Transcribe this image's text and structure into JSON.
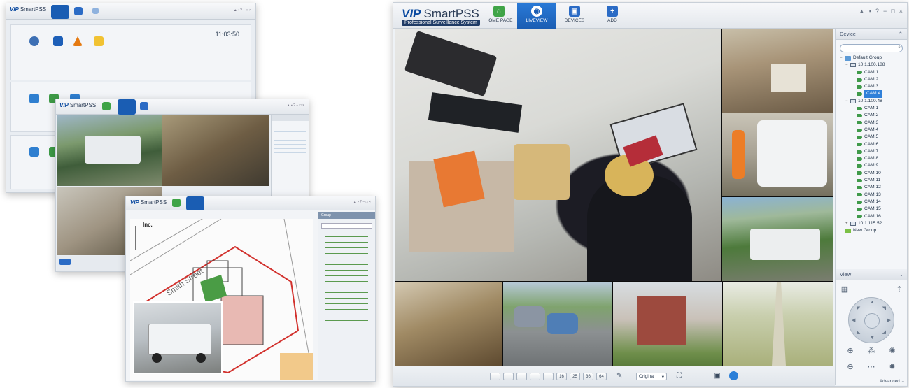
{
  "app": {
    "logo_text": "VIP",
    "product": "SmartPSS",
    "subtitle": "Professional Surveillance System"
  },
  "colors": {
    "accent": "#1a5db3",
    "selection": "#2f80d9",
    "camera_icon": "#3f9a4a"
  },
  "nav_tabs": [
    {
      "label": "HOME PAGE",
      "icon": "home-icon",
      "color": "#3fa447"
    },
    {
      "label": "LIVEVIEW",
      "icon": "camera-icon",
      "color": "#ffffff",
      "active": true
    },
    {
      "label": "DEVICES",
      "icon": "devices-icon",
      "color": "#2b6bc5"
    },
    {
      "label": "ADD",
      "icon": "plus-icon",
      "color": "#2b6bc5"
    }
  ],
  "sidebar": {
    "device_header": "Device",
    "root_group": "Default Group",
    "devices": [
      {
        "ip": "10.1.100.188",
        "cameras": [
          "CAM 1",
          "CAM 2",
          "CAM 3",
          "CAM 4"
        ],
        "selected": "CAM 4"
      },
      {
        "ip": "10.1.100.48",
        "cameras": [
          "CAM 1",
          "CAM 2",
          "CAM 3",
          "CAM 4",
          "CAM 5",
          "CAM 6",
          "CAM 7",
          "CAM 8",
          "CAM 9",
          "CAM 10",
          "CAM 11",
          "CAM 12",
          "CAM 13",
          "CAM 14",
          "CAM 15",
          "CAM 16"
        ]
      },
      {
        "ip": "10.1.115.52",
        "cameras": []
      }
    ],
    "new_group": "New Group",
    "view_header": "View",
    "advanced": "Advanced"
  },
  "bottom_bar": {
    "layouts": [
      "",
      "",
      "",
      "",
      "",
      "16",
      "25",
      "36",
      "64"
    ],
    "ratio": "Original"
  },
  "home_window": {
    "clock": "11:03:50"
  },
  "map_window": {
    "street": "Smith Street",
    "panel_title": "Group",
    "company": "Inc."
  }
}
